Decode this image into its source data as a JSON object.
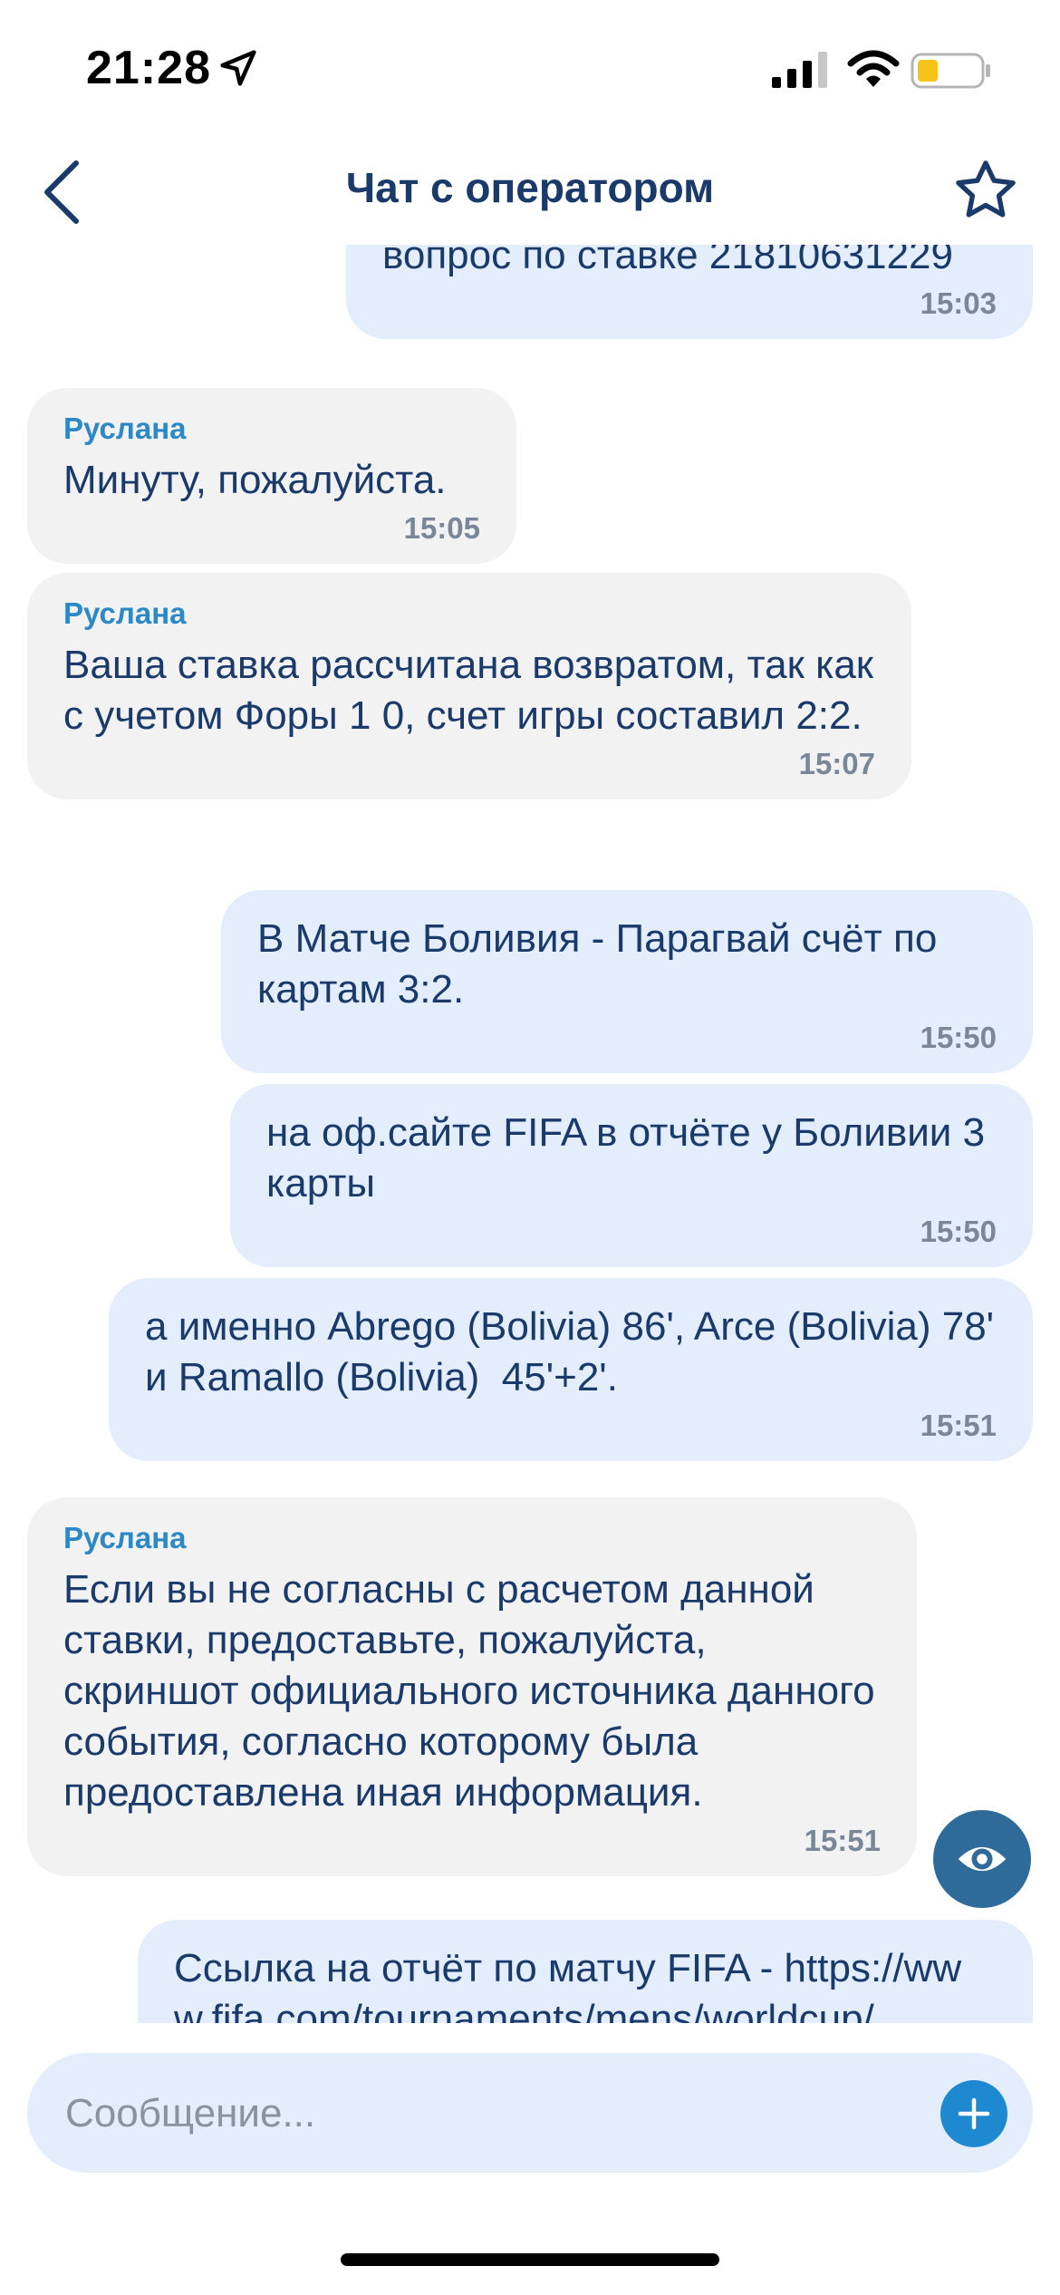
{
  "status_bar": {
    "time": "21:28",
    "battery_color": "#f6c419"
  },
  "header": {
    "title": "Чат с оператором",
    "back_icon": "chevron-left-icon",
    "favorite_icon": "star-outline-icon"
  },
  "colors": {
    "primary_text": "#1a3a6b",
    "sender_name": "#2d88c6",
    "incoming_bubble": "#f2f2f2",
    "outgoing_bubble": "#e3edfb",
    "accent": "#1e88d0",
    "fab": "#2e6a9a"
  },
  "messages": [
    {
      "direction": "out",
      "sender": "",
      "text": "вопрос по ставке 21810631229",
      "time": "15:03"
    },
    {
      "direction": "in",
      "sender": "Руслана",
      "text": "Минуту, пожалуйста.",
      "time": "15:05"
    },
    {
      "direction": "in",
      "sender": "Руслана",
      "text": "Ваша ставка рассчитана возвратом, так как с учетом Форы 1 0, счет игры составил 2:2.",
      "time": "15:07"
    },
    {
      "direction": "out",
      "sender": "",
      "text": "В Матче Боливия - Парагвай счёт по картам 3:2.",
      "time": "15:50"
    },
    {
      "direction": "out",
      "sender": "",
      "text": "на оф.сайте FIFA в отчёте у Боливии 3 карты",
      "time": "15:50"
    },
    {
      "direction": "out",
      "sender": "",
      "text": "а именно Abrego (Bolivia) 86', Arce (Bolivia) 78' и Ramallo (Bolivia)  45'+2'.",
      "time": "15:51"
    },
    {
      "direction": "in",
      "sender": "Руслана",
      "text": "Если вы не согласны с расчетом данной ставки, предоставьте, пожалуйста, скриншот официального источника данного события, согласно которому была предоставлена иная информация.",
      "time": "15:51"
    },
    {
      "direction": "out",
      "sender": "",
      "text": "Ссылка на отчёт по матчу FIFA - https://www.fifa.com/tournaments/mens/worldcup/",
      "time": ""
    }
  ],
  "fab": {
    "icon": "eye-icon"
  },
  "composer": {
    "placeholder": "Сообщение...",
    "value": "",
    "attach_icon": "plus-icon"
  }
}
